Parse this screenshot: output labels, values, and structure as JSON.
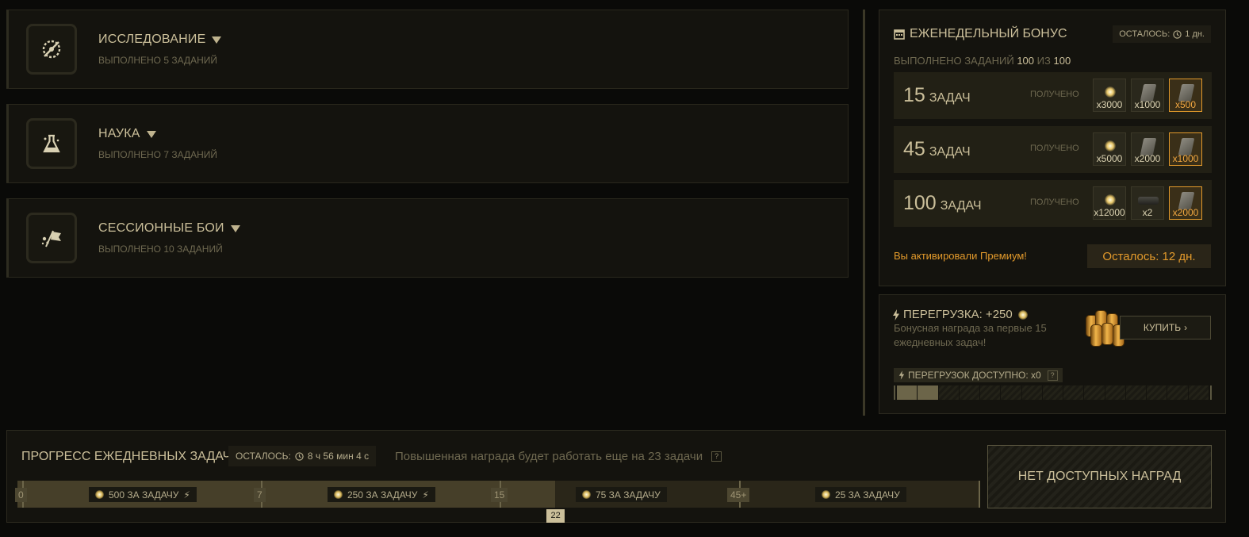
{
  "categories": [
    {
      "title": "ИССЛЕДОВАНИЕ",
      "subtitle": "ВЫПОЛНЕНО 5 ЗАДАНИЙ",
      "icon": "compass-icon"
    },
    {
      "title": "НАУКА",
      "subtitle": "ВЫПОЛНЕНО 7 ЗАДАНИЙ",
      "icon": "flask-icon"
    },
    {
      "title": "СЕССИОННЫЕ БОИ",
      "subtitle": "ВЫПОЛНЕНО 10 ЗАДАНИЙ",
      "icon": "battle-flag-icon"
    }
  ],
  "weekly": {
    "title": "ЕЖЕНЕДЕЛЬНЫЙ БОНУС",
    "remaining_label": "ОСТАЛОСЬ:",
    "remaining_value": "1 дн.",
    "done_label": "ВЫПОЛНЕНО ЗАДАНИЙ",
    "done_value": "100",
    "of_label": "ИЗ",
    "total_value": "100",
    "tiers": [
      {
        "count": "15",
        "word": "ЗАДАЧ",
        "status": "ПОЛУЧЕНО",
        "rewards": [
          {
            "kind": "coin",
            "amount": "x3000"
          },
          {
            "kind": "plate",
            "amount": "x1000"
          },
          {
            "kind": "plate-premium",
            "amount": "x500"
          }
        ]
      },
      {
        "count": "45",
        "word": "ЗАДАЧ",
        "status": "ПОЛУЧЕНО",
        "rewards": [
          {
            "kind": "coin",
            "amount": "x5000"
          },
          {
            "kind": "plate",
            "amount": "x2000"
          },
          {
            "kind": "plate-premium",
            "amount": "x1000"
          }
        ]
      },
      {
        "count": "100",
        "word": "ЗАДАЧ",
        "status": "ПОЛУЧЕНО",
        "rewards": [
          {
            "kind": "coin",
            "amount": "x12000"
          },
          {
            "kind": "cap",
            "amount": "x2"
          },
          {
            "kind": "plate-premium",
            "amount": "x2000"
          }
        ]
      }
    ],
    "premium_text": "Вы активировали Премиум!",
    "premium_remaining": "Осталось: 12 дн."
  },
  "overload": {
    "title": "ПЕРЕГРУЗКА: +250",
    "description": "Бонусная награда за первые 15 ежедневных задач!",
    "buy_label": "КУПИТЬ",
    "available_label": "ПЕРЕГРУЗОК ДОСТУПНО: x0",
    "help": "?",
    "segments_total": 15,
    "segments_filled": 2
  },
  "daily": {
    "title": "ПРОГРЕСС ЕЖЕДНЕВНЫХ ЗАДАЧ",
    "remaining_label": "ОСТАЛОСЬ:",
    "remaining_value": "8 ч 56 мин 4 с",
    "message": "Повышенная награда будет работать еще на 23 задачи",
    "help": "?",
    "current": "22",
    "ticks": [
      "0",
      "7",
      "15",
      "45+"
    ],
    "rewards": [
      {
        "label": "500 ЗА ЗАДАЧУ",
        "bolt": true
      },
      {
        "label": "250 ЗА ЗАДАЧУ",
        "bolt": true
      },
      {
        "label": "75 ЗА ЗАДАЧУ",
        "bolt": false
      },
      {
        "label": "25 ЗА ЗАДАЧУ",
        "bolt": false
      }
    ],
    "no_rewards_label": "НЕТ ДОСТУПНЫХ НАГРАД"
  },
  "colors": {
    "accent": "#e39a2b",
    "text": "#cbbf9a",
    "muted": "#6e6850",
    "panel": "#14130e"
  }
}
